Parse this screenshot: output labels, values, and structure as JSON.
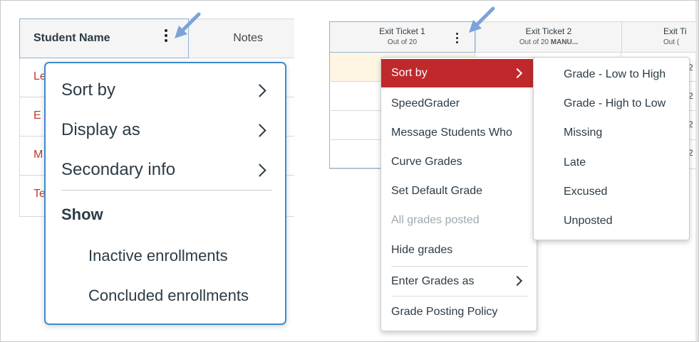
{
  "left": {
    "header": {
      "student_name": "Student Name",
      "notes": "Notes"
    },
    "rows": [
      "Le",
      "E",
      "M",
      "Te"
    ],
    "menu": {
      "items": [
        "Sort by",
        "Display as",
        "Secondary info"
      ],
      "show_heading": "Show",
      "show_items": [
        "Inactive enrollments",
        "Concluded enrollments"
      ]
    }
  },
  "right": {
    "columns": [
      {
        "title": "Exit Ticket 1",
        "subtitle": "Out of 20"
      },
      {
        "title": "Exit Ticket 2",
        "subtitle": "Out of 20",
        "subtitle_bold": "MANU..."
      },
      {
        "title": "Exit Ti",
        "subtitle": "Out ("
      }
    ],
    "row_values": [
      "2",
      "2",
      "2",
      "2"
    ],
    "menu": {
      "items": [
        "Sort by",
        "SpeedGrader",
        "Message Students Who",
        "Curve Grades",
        "Set Default Grade",
        "All grades posted",
        "Hide grades",
        "Enter Grades as",
        "Grade Posting Policy"
      ]
    },
    "submenu": {
      "items": [
        "Grade - Low to High",
        "Grade - High to Low",
        "Missing",
        "Late",
        "Excused",
        "Unposted"
      ]
    }
  },
  "colors": {
    "accent_red": "#c0292b",
    "focus_blue": "#3e8bcc",
    "arrow_blue": "#7ba3d8",
    "student_link_red": "#c0392b"
  }
}
